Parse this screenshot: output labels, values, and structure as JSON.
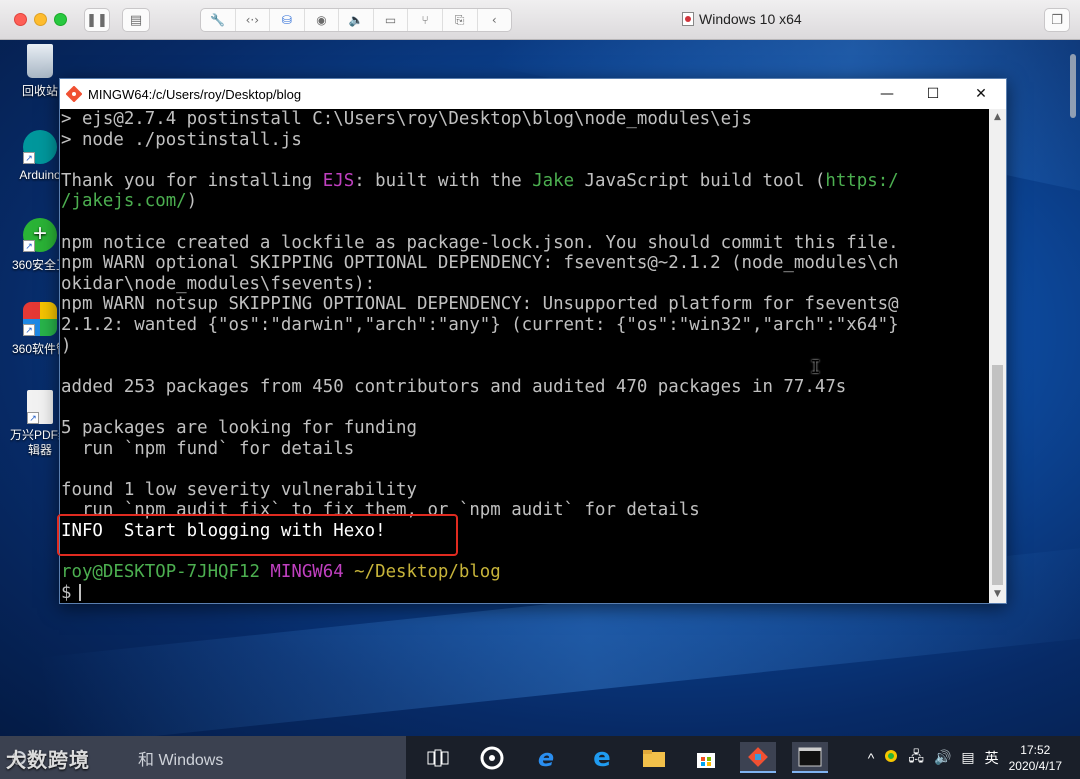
{
  "vm": {
    "title": "Windows 10 x64"
  },
  "desktop": {
    "icons": [
      {
        "label": "回收站",
        "name": "recycle-bin"
      },
      {
        "label": "Arduino",
        "name": "arduino"
      },
      {
        "label": "360安全卫",
        "name": "360-safe"
      },
      {
        "label": "360软件管",
        "name": "360-software"
      },
      {
        "label": "万兴PDF编辑器",
        "name": "wondershare-pdf"
      }
    ]
  },
  "terminal": {
    "title": "MINGW64:/c/Users/roy/Desktop/blog",
    "lines": [
      [
        {
          "t": "> ejs@2.7.4 postinstall C:\\Users\\roy\\Desktop\\blog\\node_modules\\ejs",
          "c": ""
        }
      ],
      [
        {
          "t": "> node ./postinstall.js",
          "c": ""
        }
      ],
      [
        {
          "t": "",
          "c": ""
        }
      ],
      [
        {
          "t": "Thank you for installing ",
          "c": ""
        },
        {
          "t": "EJS",
          "c": "c-magenta"
        },
        {
          "t": ": built with the ",
          "c": ""
        },
        {
          "t": "Jake",
          "c": "c-green"
        },
        {
          "t": " JavaScript build tool (",
          "c": ""
        },
        {
          "t": "https:/",
          "c": "c-green"
        }
      ],
      [
        {
          "t": "/jakejs.com/",
          "c": "c-green"
        },
        {
          "t": ")",
          "c": ""
        }
      ],
      [
        {
          "t": "",
          "c": ""
        }
      ],
      [
        {
          "t": "npm notice created a lockfile as package-lock.json. You should commit this file.",
          "c": ""
        }
      ],
      [
        {
          "t": "npm WARN optional SKIPPING OPTIONAL DEPENDENCY: fsevents@~2.1.2 (node_modules\\ch",
          "c": ""
        }
      ],
      [
        {
          "t": "okidar\\node_modules\\fsevents):",
          "c": ""
        }
      ],
      [
        {
          "t": "npm WARN notsup SKIPPING OPTIONAL DEPENDENCY: Unsupported platform for fsevents@",
          "c": ""
        }
      ],
      [
        {
          "t": "2.1.2: wanted {\"os\":\"darwin\",\"arch\":\"any\"} (current: {\"os\":\"win32\",\"arch\":\"x64\"}",
          "c": ""
        }
      ],
      [
        {
          "t": ")",
          "c": ""
        }
      ],
      [
        {
          "t": "",
          "c": ""
        }
      ],
      [
        {
          "t": "added 253 packages from 450 contributors and audited 470 packages in 77.47s",
          "c": ""
        }
      ],
      [
        {
          "t": "",
          "c": ""
        }
      ],
      [
        {
          "t": "5 packages are looking for funding",
          "c": ""
        }
      ],
      [
        {
          "t": "  run `npm fund` for details",
          "c": ""
        }
      ],
      [
        {
          "t": "",
          "c": ""
        }
      ],
      [
        {
          "t": "found 1 low severity vulnerability",
          "c": ""
        }
      ],
      [
        {
          "t": "  run `npm audit fix` to fix them, or `npm audit` for details",
          "c": ""
        }
      ],
      [
        {
          "t": "INFO  Start blogging with Hexo!",
          "c": "c-white"
        }
      ],
      [
        {
          "t": "",
          "c": ""
        }
      ],
      [
        {
          "t": "roy@DESKTOP-7JHQF12 ",
          "c": "c-green"
        },
        {
          "t": "MINGW64 ",
          "c": "c-magenta"
        },
        {
          "t": "~/Desktop/blog",
          "c": "c-yellow"
        }
      ],
      [
        {
          "t": "$",
          "c": ""
        }
      ]
    ]
  },
  "taskbar": {
    "search_label": "和 Windows",
    "watermark": "大数跨境",
    "tray": {
      "ime": "英",
      "time": "17:52",
      "date": "2020/4/17"
    }
  },
  "colors": {
    "terminal_bg": "#000000",
    "prompt_green": "#4caf50",
    "prompt_magenta": "#c040c0",
    "path_yellow": "#c7b43a",
    "highlight_red": "#e02b20"
  }
}
